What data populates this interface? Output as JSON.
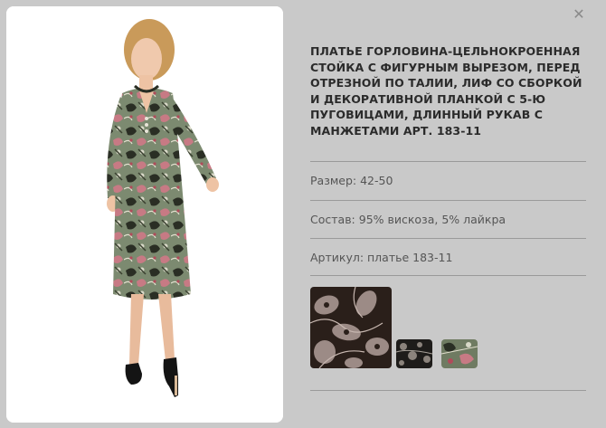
{
  "product": {
    "title": "ПЛАТЬЕ ГОРЛОВИНА-ЦЕЛЬНОКРОЕННАЯ СТОЙКА С ФИГУРНЫМ ВЫРЕЗОМ, ПЕРЕД ОТРЕЗНОЙ ПО ТАЛИИ, ЛИФ СО СБОРКОЙ И ДЕКОРАТИВНОЙ ПЛАНКОЙ С 5-Ю ПУГОВИЦАМИ, ДЛИННЫЙ РУКАВ С МАНЖЕТАМИ АРТ. 183-11",
    "size": "Размер: 42-50",
    "composition": "Состав: 95% вискоза, 5% лайкра",
    "article": "Артикул: платье 183-11"
  },
  "close_icon": "close-icon",
  "colors": {
    "background": "#c9c9c9",
    "photo_background": "#ffffff",
    "title": "#2b2b2b",
    "text": "#555555",
    "divider": "#9a9a9a"
  },
  "swatches": [
    {
      "name": "black-floral-swatch"
    },
    {
      "name": "dark-patterned-swatch"
    },
    {
      "name": "green-paisley-swatch"
    }
  ]
}
